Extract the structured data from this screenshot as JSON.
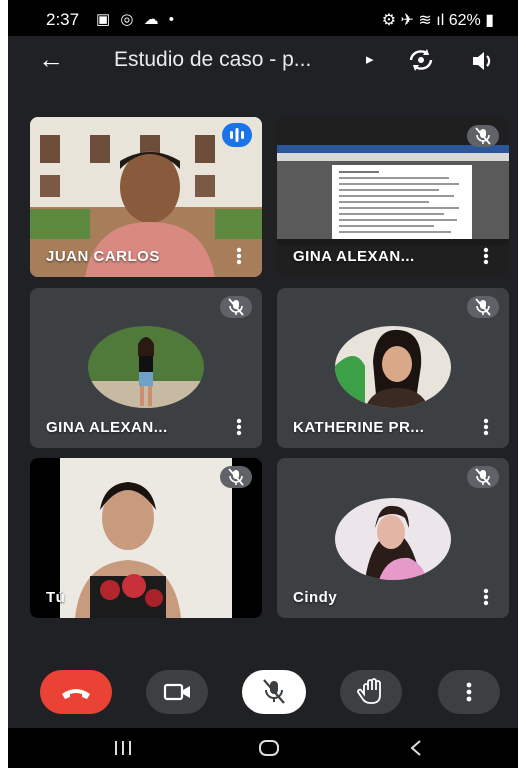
{
  "status_bar": {
    "time": "2:37",
    "left_icons": "▣ ◎ ☁ •",
    "battery": "62%"
  },
  "header": {
    "title": "Estudio de caso - p...",
    "title_arrow": "▸",
    "back_icon": "arrow-left-icon"
  },
  "participants": [
    {
      "name": "JUAN CARLOS",
      "state": "speaking"
    },
    {
      "name": "GINA ALEXAN...",
      "state": "muted",
      "content": "screen-share"
    },
    {
      "name": "GINA ALEXAN...",
      "state": "muted"
    },
    {
      "name": "KATHERINE PR...",
      "state": "muted"
    },
    {
      "name": "Tú",
      "state": "muted"
    },
    {
      "name": "Cindy",
      "state": "muted"
    }
  ],
  "colors": {
    "background": "#202124",
    "tile": "#3c4043",
    "end_call": "#ea4335",
    "speaking": "#1a73e8",
    "control": "#3c4043"
  }
}
